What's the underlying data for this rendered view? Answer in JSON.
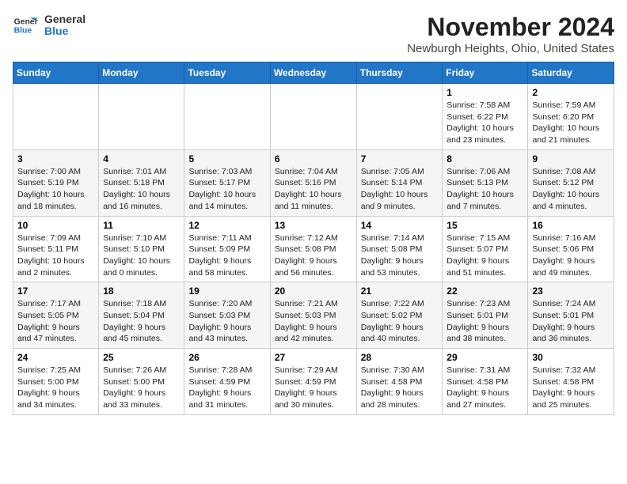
{
  "logo": {
    "line1": "General",
    "line2": "Blue"
  },
  "title": "November 2024",
  "location": "Newburgh Heights, Ohio, United States",
  "days_header": [
    "Sunday",
    "Monday",
    "Tuesday",
    "Wednesday",
    "Thursday",
    "Friday",
    "Saturday"
  ],
  "weeks": [
    [
      {
        "day": "",
        "info": ""
      },
      {
        "day": "",
        "info": ""
      },
      {
        "day": "",
        "info": ""
      },
      {
        "day": "",
        "info": ""
      },
      {
        "day": "",
        "info": ""
      },
      {
        "day": "1",
        "info": "Sunrise: 7:58 AM\nSunset: 6:22 PM\nDaylight: 10 hours and 23 minutes."
      },
      {
        "day": "2",
        "info": "Sunrise: 7:59 AM\nSunset: 6:20 PM\nDaylight: 10 hours and 21 minutes."
      }
    ],
    [
      {
        "day": "3",
        "info": "Sunrise: 7:00 AM\nSunset: 5:19 PM\nDaylight: 10 hours and 18 minutes."
      },
      {
        "day": "4",
        "info": "Sunrise: 7:01 AM\nSunset: 5:18 PM\nDaylight: 10 hours and 16 minutes."
      },
      {
        "day": "5",
        "info": "Sunrise: 7:03 AM\nSunset: 5:17 PM\nDaylight: 10 hours and 14 minutes."
      },
      {
        "day": "6",
        "info": "Sunrise: 7:04 AM\nSunset: 5:16 PM\nDaylight: 10 hours and 11 minutes."
      },
      {
        "day": "7",
        "info": "Sunrise: 7:05 AM\nSunset: 5:14 PM\nDaylight: 10 hours and 9 minutes."
      },
      {
        "day": "8",
        "info": "Sunrise: 7:06 AM\nSunset: 5:13 PM\nDaylight: 10 hours and 7 minutes."
      },
      {
        "day": "9",
        "info": "Sunrise: 7:08 AM\nSunset: 5:12 PM\nDaylight: 10 hours and 4 minutes."
      }
    ],
    [
      {
        "day": "10",
        "info": "Sunrise: 7:09 AM\nSunset: 5:11 PM\nDaylight: 10 hours and 2 minutes."
      },
      {
        "day": "11",
        "info": "Sunrise: 7:10 AM\nSunset: 5:10 PM\nDaylight: 10 hours and 0 minutes."
      },
      {
        "day": "12",
        "info": "Sunrise: 7:11 AM\nSunset: 5:09 PM\nDaylight: 9 hours and 58 minutes."
      },
      {
        "day": "13",
        "info": "Sunrise: 7:12 AM\nSunset: 5:08 PM\nDaylight: 9 hours and 56 minutes."
      },
      {
        "day": "14",
        "info": "Sunrise: 7:14 AM\nSunset: 5:08 PM\nDaylight: 9 hours and 53 minutes."
      },
      {
        "day": "15",
        "info": "Sunrise: 7:15 AM\nSunset: 5:07 PM\nDaylight: 9 hours and 51 minutes."
      },
      {
        "day": "16",
        "info": "Sunrise: 7:16 AM\nSunset: 5:06 PM\nDaylight: 9 hours and 49 minutes."
      }
    ],
    [
      {
        "day": "17",
        "info": "Sunrise: 7:17 AM\nSunset: 5:05 PM\nDaylight: 9 hours and 47 minutes."
      },
      {
        "day": "18",
        "info": "Sunrise: 7:18 AM\nSunset: 5:04 PM\nDaylight: 9 hours and 45 minutes."
      },
      {
        "day": "19",
        "info": "Sunrise: 7:20 AM\nSunset: 5:03 PM\nDaylight: 9 hours and 43 minutes."
      },
      {
        "day": "20",
        "info": "Sunrise: 7:21 AM\nSunset: 5:03 PM\nDaylight: 9 hours and 42 minutes."
      },
      {
        "day": "21",
        "info": "Sunrise: 7:22 AM\nSunset: 5:02 PM\nDaylight: 9 hours and 40 minutes."
      },
      {
        "day": "22",
        "info": "Sunrise: 7:23 AM\nSunset: 5:01 PM\nDaylight: 9 hours and 38 minutes."
      },
      {
        "day": "23",
        "info": "Sunrise: 7:24 AM\nSunset: 5:01 PM\nDaylight: 9 hours and 36 minutes."
      }
    ],
    [
      {
        "day": "24",
        "info": "Sunrise: 7:25 AM\nSunset: 5:00 PM\nDaylight: 9 hours and 34 minutes."
      },
      {
        "day": "25",
        "info": "Sunrise: 7:26 AM\nSunset: 5:00 PM\nDaylight: 9 hours and 33 minutes."
      },
      {
        "day": "26",
        "info": "Sunrise: 7:28 AM\nSunset: 4:59 PM\nDaylight: 9 hours and 31 minutes."
      },
      {
        "day": "27",
        "info": "Sunrise: 7:29 AM\nSunset: 4:59 PM\nDaylight: 9 hours and 30 minutes."
      },
      {
        "day": "28",
        "info": "Sunrise: 7:30 AM\nSunset: 4:58 PM\nDaylight: 9 hours and 28 minutes."
      },
      {
        "day": "29",
        "info": "Sunrise: 7:31 AM\nSunset: 4:58 PM\nDaylight: 9 hours and 27 minutes."
      },
      {
        "day": "30",
        "info": "Sunrise: 7:32 AM\nSunset: 4:58 PM\nDaylight: 9 hours and 25 minutes."
      }
    ]
  ]
}
